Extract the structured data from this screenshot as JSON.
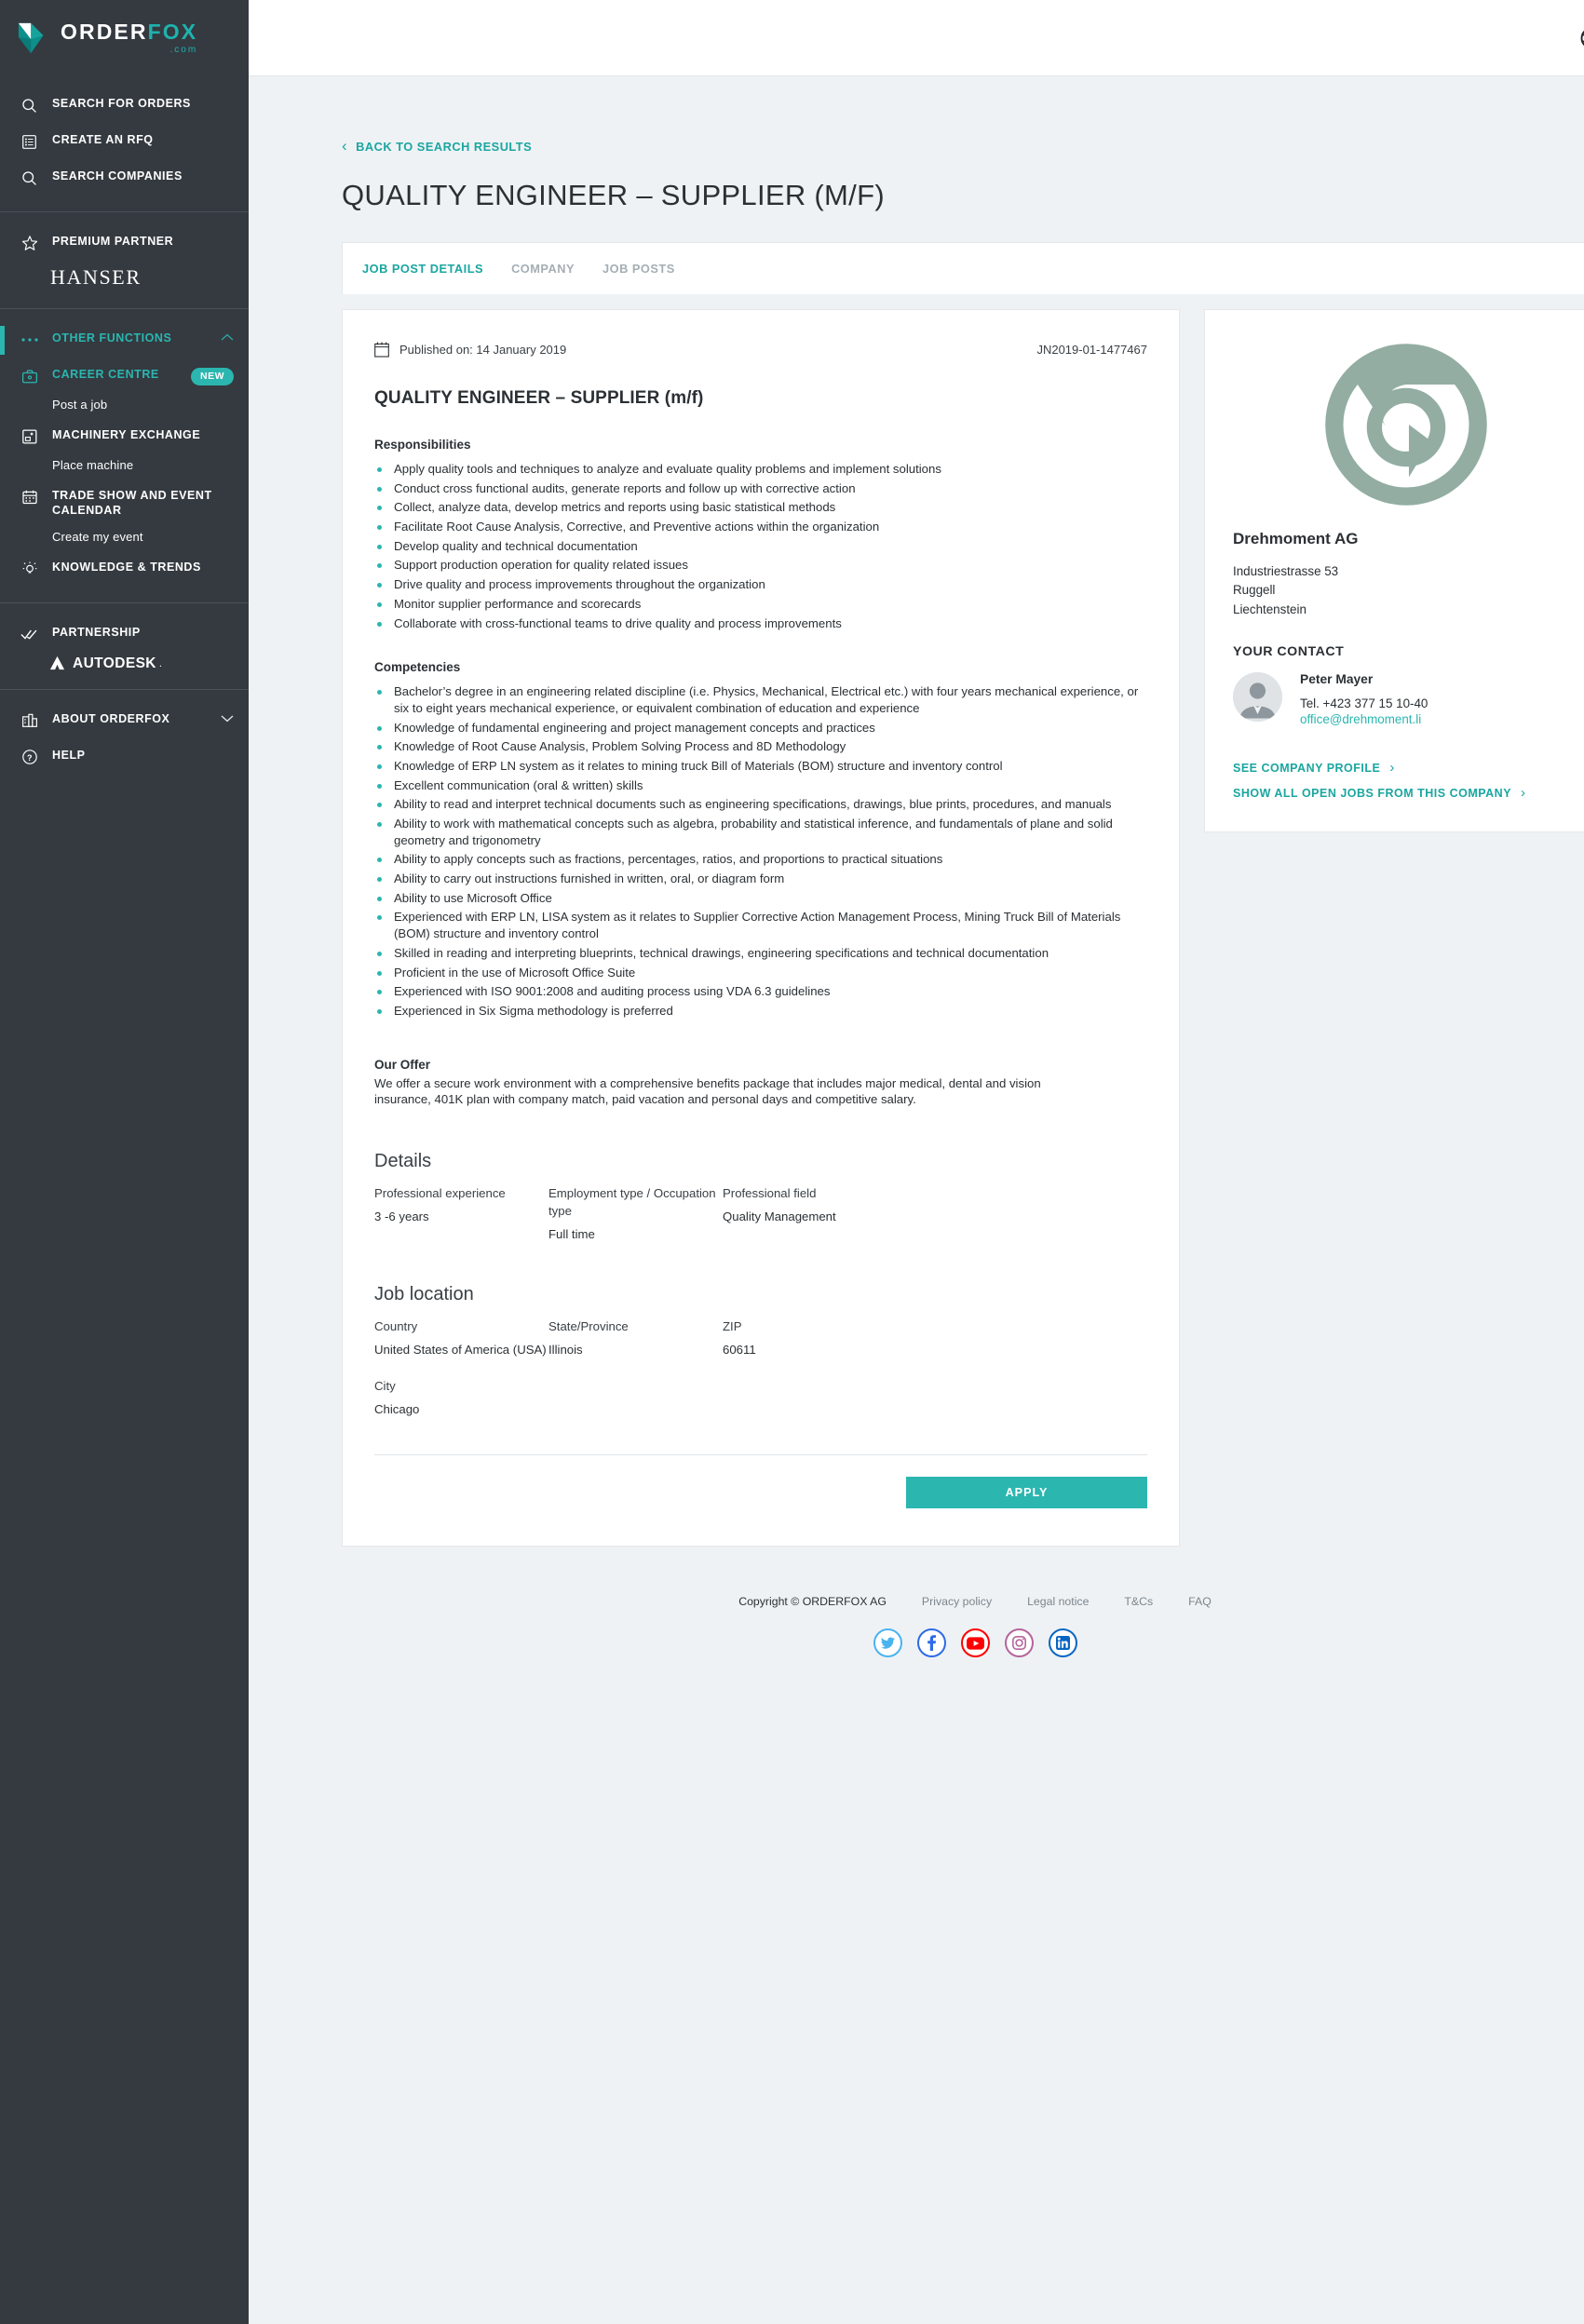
{
  "brand": {
    "logo_primary": "ORDER",
    "logo_secondary": "FOX",
    "logo_suffix": ".com",
    "accent": "#2bb6b0",
    "sidebar_bg": "#343a40"
  },
  "sidebar": {
    "groups": [
      {
        "items": [
          {
            "label": "SEARCH FOR ORDERS",
            "icon": "search-icon"
          },
          {
            "label": "CREATE AN RFQ",
            "icon": "list-document-icon"
          },
          {
            "label": "SEARCH COMPANIES",
            "icon": "search-icon"
          }
        ]
      },
      {
        "items": [
          {
            "label": "PREMIUM PARTNER",
            "icon": "star-icon"
          }
        ],
        "partner_name": "HANSER"
      },
      {
        "items": [
          {
            "label": "OTHER FUNCTIONS",
            "icon": "ellipsis-icon",
            "teal": true,
            "chevron": "up"
          },
          {
            "label": "CAREER CENTRE",
            "icon": "briefcase-icon",
            "teal": true,
            "badge": "NEW",
            "sub": "Post a job"
          },
          {
            "label": "MACHINERY EXCHANGE",
            "icon": "machine-icon",
            "sub": "Place machine"
          },
          {
            "label": "TRADE SHOW AND EVENT CALENDAR",
            "icon": "calendar-icon",
            "sub": "Create my event"
          },
          {
            "label": "KNOWLEDGE & TRENDS",
            "icon": "lightbulb-icon"
          }
        ]
      },
      {
        "items": [
          {
            "label": "PARTNERSHIP",
            "icon": "double-check-icon"
          }
        ],
        "autodesk": "AUTODESK"
      },
      {
        "items": [
          {
            "label": "ABOUT ORDERFOX",
            "icon": "buildings-icon",
            "chevron": "down"
          },
          {
            "label": "HELP",
            "icon": "question-circle-icon"
          }
        ]
      }
    ]
  },
  "topbar": {
    "globe_icon": "globe-icon",
    "avatar_icon": "user-avatar"
  },
  "header": {
    "back_label": "BACK TO SEARCH RESULTS",
    "title": "QUALITY ENGINEER – SUPPLIER (M/F)"
  },
  "tabs": [
    {
      "label": "JOB POST DETAILS",
      "active": true
    },
    {
      "label": "COMPANY",
      "active": false
    },
    {
      "label": "JOB POSTS",
      "active": false
    }
  ],
  "job": {
    "published_label": "Published on: 14 January 2019",
    "reference": "JN2019-01-1477467",
    "heading": "QUALITY ENGINEER – SUPPLIER (m/f)",
    "responsibilities_heading": "Responsibilities",
    "responsibilities": [
      "Apply quality tools and techniques to analyze and evaluate quality problems and implement solutions",
      "Conduct cross functional audits, generate reports and follow up with corrective action",
      "Collect, analyze data, develop metrics and reports using basic statistical methods",
      "Facilitate Root Cause Analysis, Corrective, and Preventive actions within the organization",
      "Develop quality and technical documentation",
      "Support production operation for quality related issues",
      "Drive quality and process improvements throughout the organization",
      "Monitor supplier performance and scorecards",
      "Collaborate with cross-functional teams to drive quality and process improvements"
    ],
    "competencies_heading": "Competencies",
    "competencies": [
      "Bachelor’s degree in an engineering related discipline (i.e. Physics, Mechanical, Electrical etc.) with four years mechanical experience, or six to eight years mechanical experience, or equivalent combination of education and experience",
      "Knowledge of fundamental engineering and project management concepts and practices",
      "Knowledge of Root Cause Analysis, Problem Solving Process and 8D Methodology",
      "Knowledge of ERP LN system as it relates to mining truck Bill of Materials (BOM) structure and inventory control",
      "Excellent communication (oral & written) skills",
      "Ability to read and interpret technical documents such as engineering specifications, drawings, blue prints, procedures, and manuals",
      "Ability to work with mathematical concepts such as algebra, probability and statistical inference, and fundamentals of plane and solid geometry and trigonometry",
      "Ability to apply concepts such as fractions, percentages, ratios, and proportions to practical situations",
      "Ability to carry out instructions furnished in written, oral, or diagram form",
      "Ability to use Microsoft Office",
      "Experienced with ERP LN, LISA system as it relates to Supplier Corrective Action Management Process, Mining Truck Bill of Materials (BOM) structure and inventory control",
      "Skilled in reading and interpreting blueprints, technical drawings, engineering specifications and technical documentation",
      "Proficient in the use of Microsoft Office Suite",
      "Experienced with ISO 9001:2008 and auditing process using VDA 6.3 guidelines",
      "Experienced in Six Sigma methodology is preferred"
    ],
    "offer_heading": "Our Offer",
    "offer_text": "We offer a secure work environment with a comprehensive benefits package that includes major medical, dental and vision insurance, 401K plan with company match, paid vacation and personal days and competitive salary.",
    "details_heading": "Details",
    "details": [
      {
        "label": "Professional experience",
        "value": "3 -6 years"
      },
      {
        "label": "Employment type / Occupation type",
        "value": "Full time"
      },
      {
        "label": "Professional field",
        "value": "Quality Management"
      }
    ],
    "location_heading": "Job location",
    "location": [
      {
        "label": "Country",
        "value": "United States of America (USA)"
      },
      {
        "label": "State/Province",
        "value": "Illinois"
      },
      {
        "label": "ZIP",
        "value": "60611"
      },
      {
        "label": "City",
        "value": "Chicago"
      }
    ],
    "apply_label": "APPLY"
  },
  "company": {
    "logo_icon": "chrome-style-logo",
    "name": "Drehmoment AG",
    "address_lines": [
      "Industriestrasse 53",
      "Ruggell",
      "Liechtenstein"
    ],
    "contact_heading": "YOUR CONTACT",
    "contact_name": "Peter Mayer",
    "contact_tel": "Tel. +423 377 15 10-40",
    "contact_email": "office@drehmoment.li",
    "link_profile": "SEE COMPANY PROFILE",
    "link_jobs": "SHOW ALL OPEN JOBS FROM THIS COMPANY"
  },
  "footer": {
    "copyright": "Copyright © ORDERFOX AG",
    "links": [
      "Privacy policy",
      "Legal notice",
      "T&Cs",
      "FAQ"
    ],
    "socials": [
      "twitter-icon",
      "facebook-icon",
      "youtube-icon",
      "instagram-icon",
      "linkedin-icon"
    ]
  }
}
